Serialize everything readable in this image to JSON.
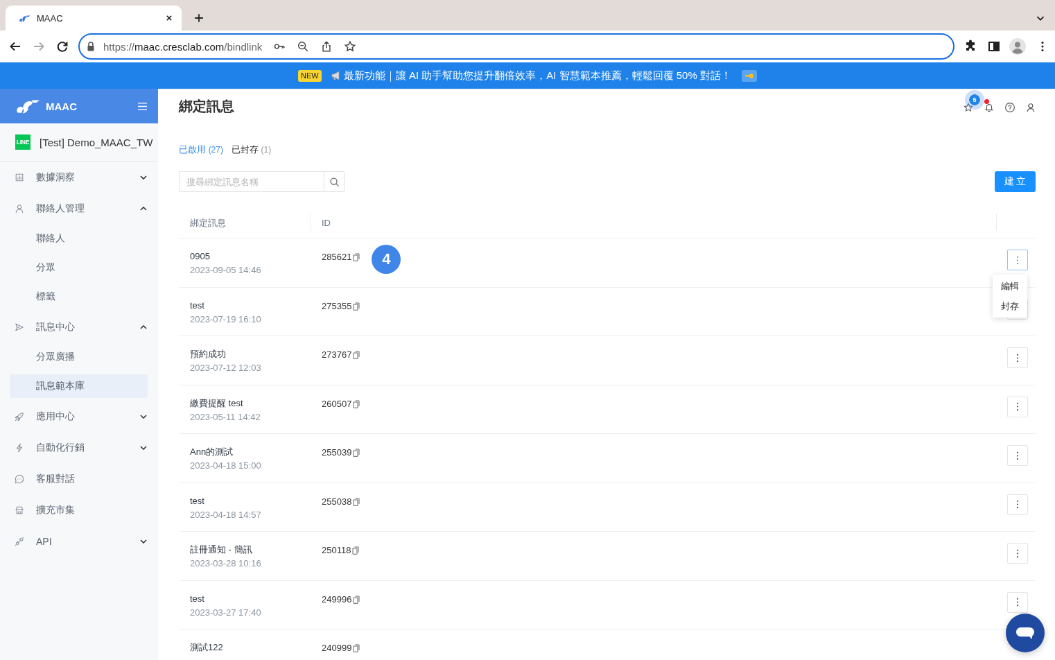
{
  "browser": {
    "tab_title": "MAAC",
    "url": {
      "scheme": "https://",
      "host": "maac.cresclab.com",
      "path": "/bindlink"
    },
    "can_go_forward": false
  },
  "banner": {
    "badge": "NEW",
    "text": "最新功能｜讓 AI 助手幫助您提升翻倍效率，AI 智慧範本推薦，輕鬆回覆 50% 對話！"
  },
  "sidebar": {
    "brand": "MAAC",
    "account": {
      "badge": "LINE",
      "name": "[Test] Demo_MAAC_TW"
    },
    "items": [
      {
        "label": "數據洞察",
        "selected": false,
        "expanded": false
      },
      {
        "label": "聯絡人管理",
        "selected": false,
        "expanded": true,
        "children": [
          {
            "label": "聯絡人",
            "selected": false
          },
          {
            "label": "分眾",
            "selected": false
          },
          {
            "label": "標籤",
            "selected": false
          }
        ]
      },
      {
        "label": "訊息中心",
        "selected": false,
        "expanded": true,
        "children": [
          {
            "label": "分眾廣播",
            "selected": false
          },
          {
            "label": "訊息範本庫",
            "selected": true
          }
        ]
      },
      {
        "label": "應用中心",
        "selected": false,
        "expanded": false
      },
      {
        "label": "自動化行銷",
        "selected": false,
        "expanded": false
      },
      {
        "label": "客服對話",
        "selected": false
      },
      {
        "label": "擴充市集",
        "selected": false
      },
      {
        "label": "API",
        "selected": false,
        "expanded": false
      }
    ]
  },
  "header": {
    "title": "綁定訊息",
    "favorites_count": "5",
    "has_alert": true
  },
  "tabs": [
    {
      "label": "已啟用",
      "count": "(27)",
      "selected": true
    },
    {
      "label": "已封存",
      "count": "(1)",
      "selected": false
    }
  ],
  "search": {
    "placeholder": "搜尋綁定訊息名稱"
  },
  "create_button": "建 立",
  "table": {
    "columns": [
      "綁定訊息",
      "ID"
    ],
    "rows": [
      {
        "name": "0905",
        "date": "2023-09-05 14:46",
        "id": "285621",
        "marker": "4",
        "menu_open": true
      },
      {
        "name": "test",
        "date": "2023-07-19 16:10",
        "id": "275355",
        "menu_open": false
      },
      {
        "name": "預約成功",
        "date": "2023-07-12 12:03",
        "id": "273767",
        "menu_open": false
      },
      {
        "name": "繳費提醒 test",
        "date": "2023-05-11 14:42",
        "id": "260507",
        "menu_open": false
      },
      {
        "name": "Ann的測試",
        "date": "2023-04-18 15:00",
        "id": "255039",
        "menu_open": false
      },
      {
        "name": "test",
        "date": "2023-04-18 14:57",
        "id": "255038",
        "menu_open": false
      },
      {
        "name": "註冊通知 - 簡訊",
        "date": "2023-03-28 10:16",
        "id": "250118",
        "menu_open": false
      },
      {
        "name": "test",
        "date": "2023-03-27 17:40",
        "id": "249996",
        "menu_open": false
      },
      {
        "name": "測試122",
        "id": "240999"
      }
    ]
  },
  "row_menu": [
    "編輯",
    "封存"
  ]
}
